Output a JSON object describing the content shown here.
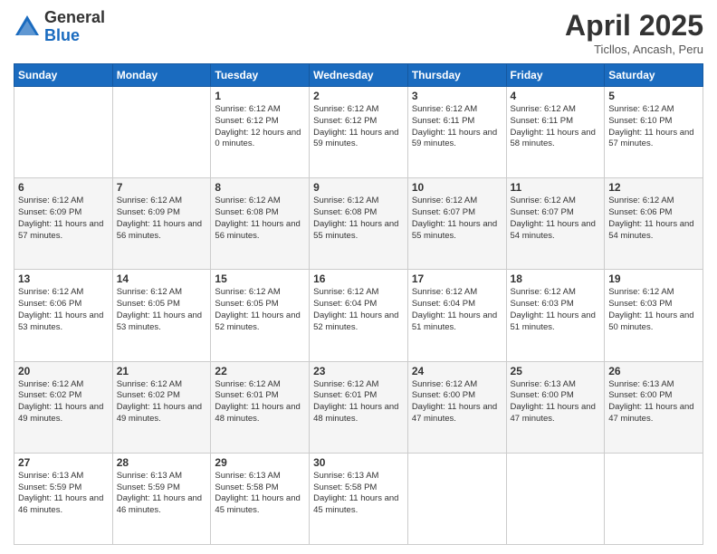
{
  "logo": {
    "general": "General",
    "blue": "Blue"
  },
  "title": "April 2025",
  "subtitle": "Ticllos, Ancash, Peru",
  "days": [
    "Sunday",
    "Monday",
    "Tuesday",
    "Wednesday",
    "Thursday",
    "Friday",
    "Saturday"
  ],
  "weeks": [
    [
      {
        "day": "",
        "info": ""
      },
      {
        "day": "",
        "info": ""
      },
      {
        "day": "1",
        "info": "Sunrise: 6:12 AM\nSunset: 6:12 PM\nDaylight: 12 hours and 0 minutes."
      },
      {
        "day": "2",
        "info": "Sunrise: 6:12 AM\nSunset: 6:12 PM\nDaylight: 11 hours and 59 minutes."
      },
      {
        "day": "3",
        "info": "Sunrise: 6:12 AM\nSunset: 6:11 PM\nDaylight: 11 hours and 59 minutes."
      },
      {
        "day": "4",
        "info": "Sunrise: 6:12 AM\nSunset: 6:11 PM\nDaylight: 11 hours and 58 minutes."
      },
      {
        "day": "5",
        "info": "Sunrise: 6:12 AM\nSunset: 6:10 PM\nDaylight: 11 hours and 57 minutes."
      }
    ],
    [
      {
        "day": "6",
        "info": "Sunrise: 6:12 AM\nSunset: 6:09 PM\nDaylight: 11 hours and 57 minutes."
      },
      {
        "day": "7",
        "info": "Sunrise: 6:12 AM\nSunset: 6:09 PM\nDaylight: 11 hours and 56 minutes."
      },
      {
        "day": "8",
        "info": "Sunrise: 6:12 AM\nSunset: 6:08 PM\nDaylight: 11 hours and 56 minutes."
      },
      {
        "day": "9",
        "info": "Sunrise: 6:12 AM\nSunset: 6:08 PM\nDaylight: 11 hours and 55 minutes."
      },
      {
        "day": "10",
        "info": "Sunrise: 6:12 AM\nSunset: 6:07 PM\nDaylight: 11 hours and 55 minutes."
      },
      {
        "day": "11",
        "info": "Sunrise: 6:12 AM\nSunset: 6:07 PM\nDaylight: 11 hours and 54 minutes."
      },
      {
        "day": "12",
        "info": "Sunrise: 6:12 AM\nSunset: 6:06 PM\nDaylight: 11 hours and 54 minutes."
      }
    ],
    [
      {
        "day": "13",
        "info": "Sunrise: 6:12 AM\nSunset: 6:06 PM\nDaylight: 11 hours and 53 minutes."
      },
      {
        "day": "14",
        "info": "Sunrise: 6:12 AM\nSunset: 6:05 PM\nDaylight: 11 hours and 53 minutes."
      },
      {
        "day": "15",
        "info": "Sunrise: 6:12 AM\nSunset: 6:05 PM\nDaylight: 11 hours and 52 minutes."
      },
      {
        "day": "16",
        "info": "Sunrise: 6:12 AM\nSunset: 6:04 PM\nDaylight: 11 hours and 52 minutes."
      },
      {
        "day": "17",
        "info": "Sunrise: 6:12 AM\nSunset: 6:04 PM\nDaylight: 11 hours and 51 minutes."
      },
      {
        "day": "18",
        "info": "Sunrise: 6:12 AM\nSunset: 6:03 PM\nDaylight: 11 hours and 51 minutes."
      },
      {
        "day": "19",
        "info": "Sunrise: 6:12 AM\nSunset: 6:03 PM\nDaylight: 11 hours and 50 minutes."
      }
    ],
    [
      {
        "day": "20",
        "info": "Sunrise: 6:12 AM\nSunset: 6:02 PM\nDaylight: 11 hours and 49 minutes."
      },
      {
        "day": "21",
        "info": "Sunrise: 6:12 AM\nSunset: 6:02 PM\nDaylight: 11 hours and 49 minutes."
      },
      {
        "day": "22",
        "info": "Sunrise: 6:12 AM\nSunset: 6:01 PM\nDaylight: 11 hours and 48 minutes."
      },
      {
        "day": "23",
        "info": "Sunrise: 6:12 AM\nSunset: 6:01 PM\nDaylight: 11 hours and 48 minutes."
      },
      {
        "day": "24",
        "info": "Sunrise: 6:12 AM\nSunset: 6:00 PM\nDaylight: 11 hours and 47 minutes."
      },
      {
        "day": "25",
        "info": "Sunrise: 6:13 AM\nSunset: 6:00 PM\nDaylight: 11 hours and 47 minutes."
      },
      {
        "day": "26",
        "info": "Sunrise: 6:13 AM\nSunset: 6:00 PM\nDaylight: 11 hours and 47 minutes."
      }
    ],
    [
      {
        "day": "27",
        "info": "Sunrise: 6:13 AM\nSunset: 5:59 PM\nDaylight: 11 hours and 46 minutes."
      },
      {
        "day": "28",
        "info": "Sunrise: 6:13 AM\nSunset: 5:59 PM\nDaylight: 11 hours and 46 minutes."
      },
      {
        "day": "29",
        "info": "Sunrise: 6:13 AM\nSunset: 5:58 PM\nDaylight: 11 hours and 45 minutes."
      },
      {
        "day": "30",
        "info": "Sunrise: 6:13 AM\nSunset: 5:58 PM\nDaylight: 11 hours and 45 minutes."
      },
      {
        "day": "",
        "info": ""
      },
      {
        "day": "",
        "info": ""
      },
      {
        "day": "",
        "info": ""
      }
    ]
  ]
}
